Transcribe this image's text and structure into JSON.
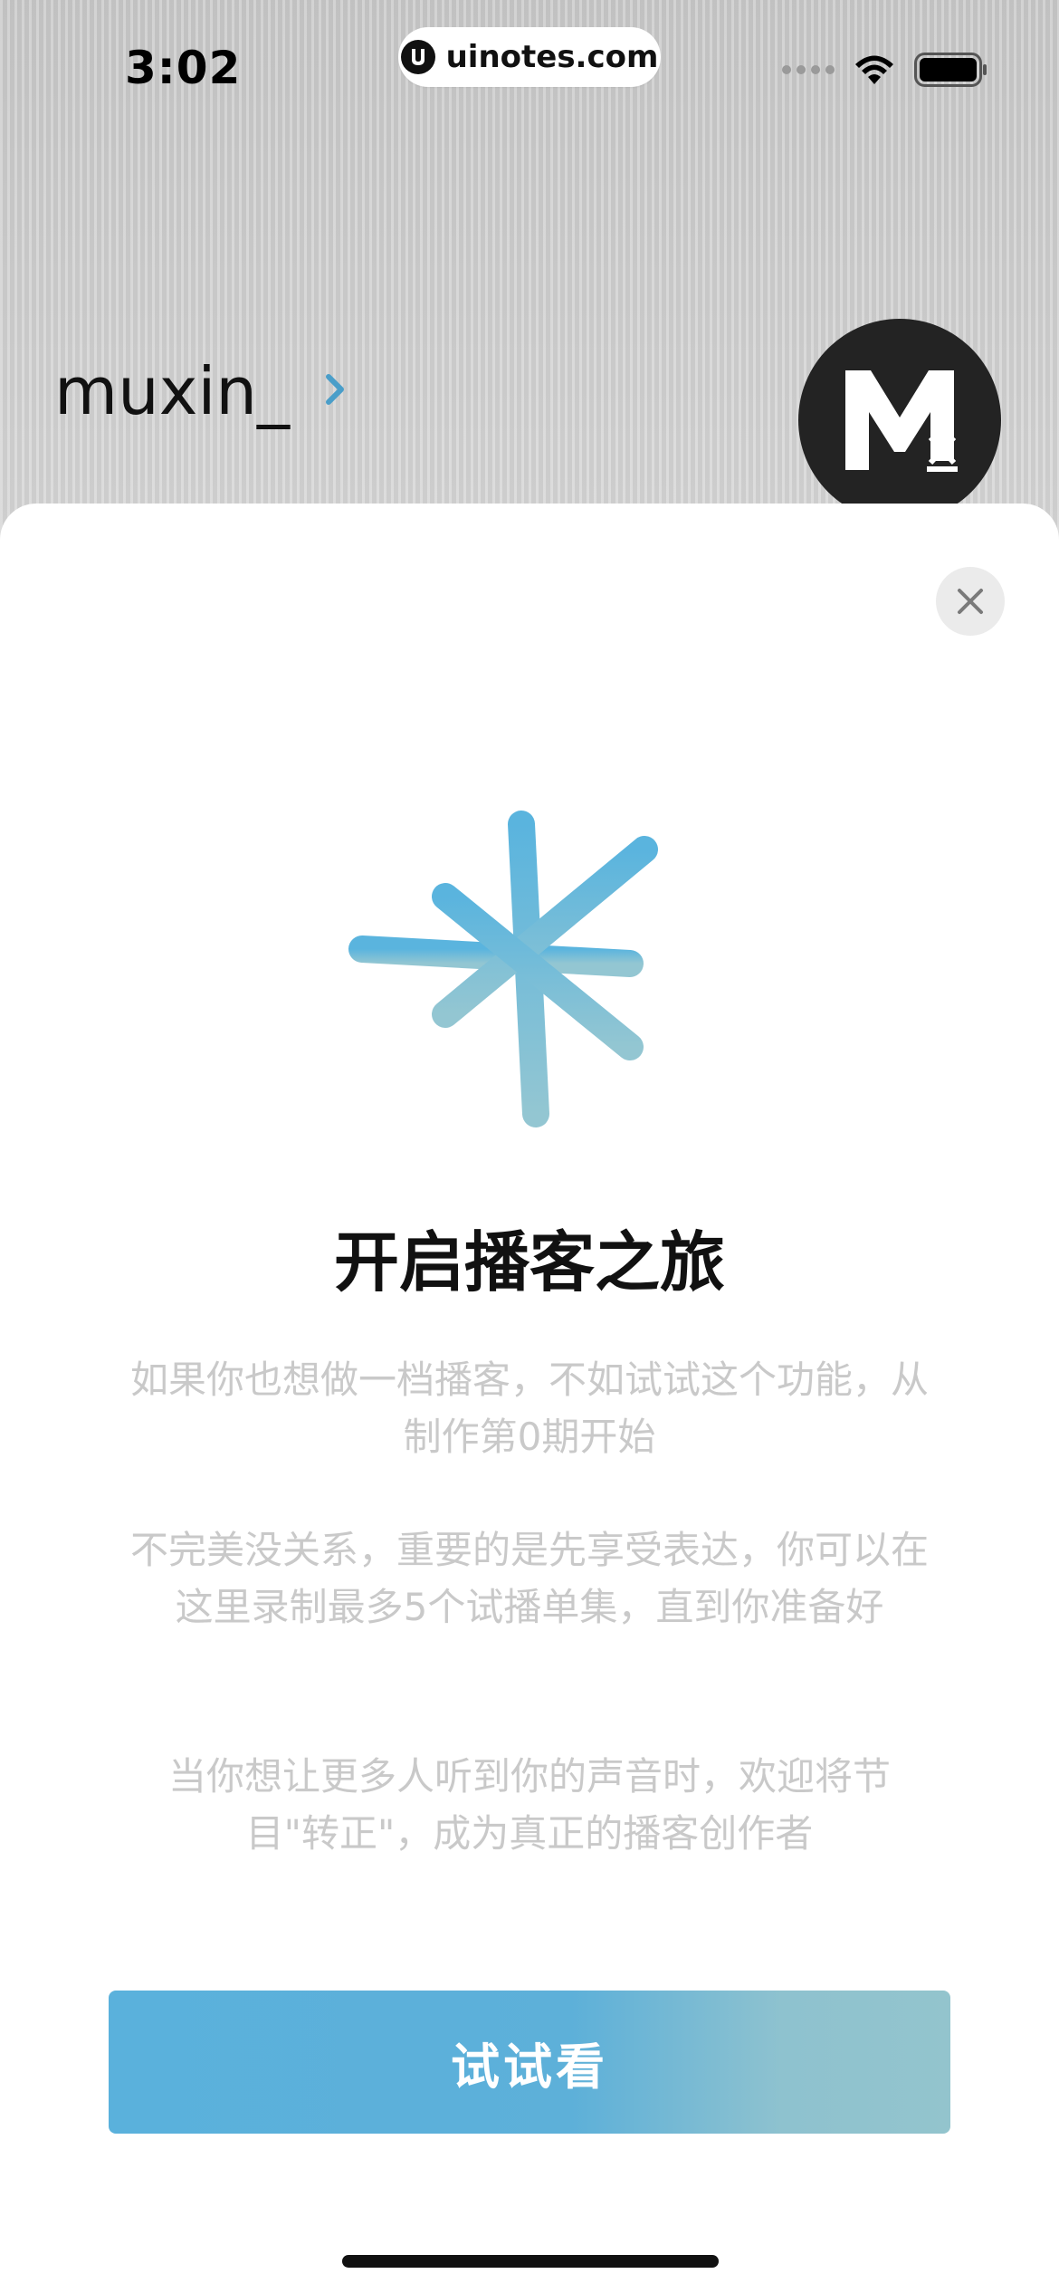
{
  "status_bar": {
    "time": "3:02"
  },
  "watermark": {
    "text": "uinotes.com"
  },
  "profile": {
    "username": "muxin_"
  },
  "sheet": {
    "title": "开启播客之旅",
    "paragraphs": [
      "如果你也想做一档播客，不如试试这个功能，从制作第0期开始",
      "不完美没关系，重要的是先享受表达，你可以在这里录制最多5个试播单集，直到你准备好",
      "当你想让更多人听到你的声音时，欢迎将节目\"转正\"，成为真正的播客创作者"
    ],
    "button_label": "试试看"
  },
  "colors": {
    "accent": "#5ab1dc",
    "accent_end": "#93c4cd",
    "text_muted": "#c9c9c9"
  }
}
